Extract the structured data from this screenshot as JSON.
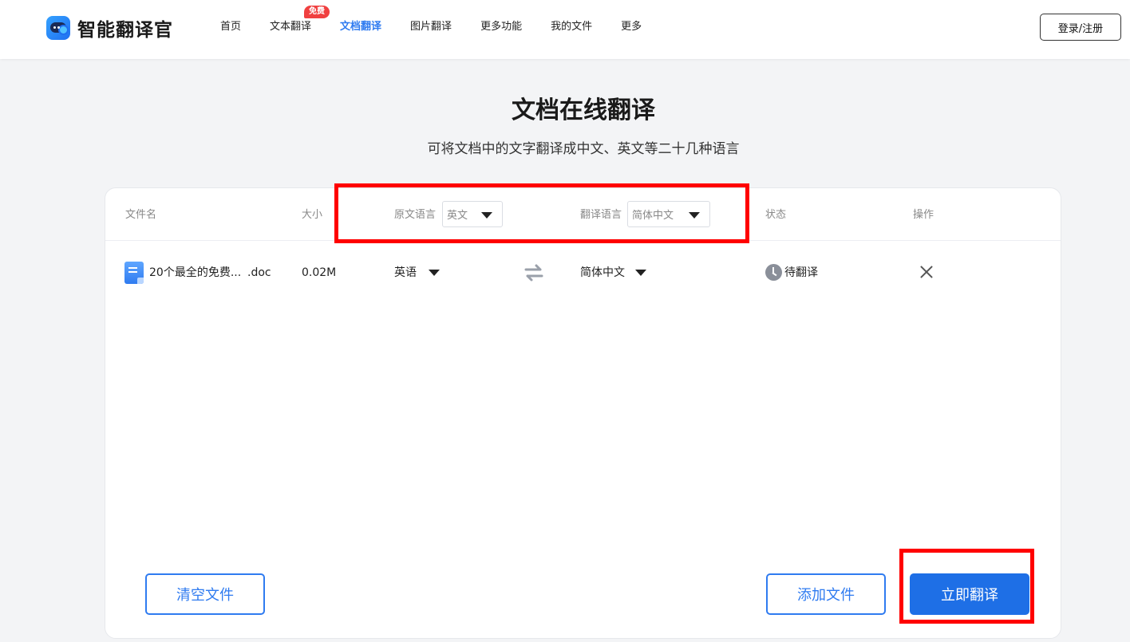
{
  "header": {
    "logo_text": "智能翻译官",
    "nav": [
      {
        "label": "首页",
        "active": false
      },
      {
        "label": "文本翻译",
        "active": false,
        "badge": "免费"
      },
      {
        "label": "文档翻译",
        "active": true
      },
      {
        "label": "图片翻译",
        "active": false
      },
      {
        "label": "更多功能",
        "active": false
      },
      {
        "label": "我的文件",
        "active": false
      },
      {
        "label": "更多",
        "active": false
      }
    ],
    "login_label": "登录/注册"
  },
  "hero": {
    "title": "文档在线翻译",
    "subtitle": "可将文档中的文字翻译成中文、英文等二十几种语言"
  },
  "table": {
    "columns": {
      "filename": "文件名",
      "size": "大小",
      "source_lang": "原文语言",
      "target_lang": "翻译语言",
      "status": "状态",
      "action": "操作"
    },
    "source_lang_select": "英文",
    "target_lang_select": "简体中文",
    "rows": [
      {
        "filename": "20个最全的免费...",
        "ext": ".doc",
        "size": "0.02M",
        "source_lang": "英语",
        "target_lang": "简体中文",
        "status": "待翻译"
      }
    ]
  },
  "actions": {
    "clear": "清空文件",
    "add": "添加文件",
    "translate": "立即翻译"
  },
  "colors": {
    "accent": "#2f7bf0",
    "primary_button": "#1e6fe6",
    "badge": "#f04040",
    "highlight": "#ff0000"
  }
}
